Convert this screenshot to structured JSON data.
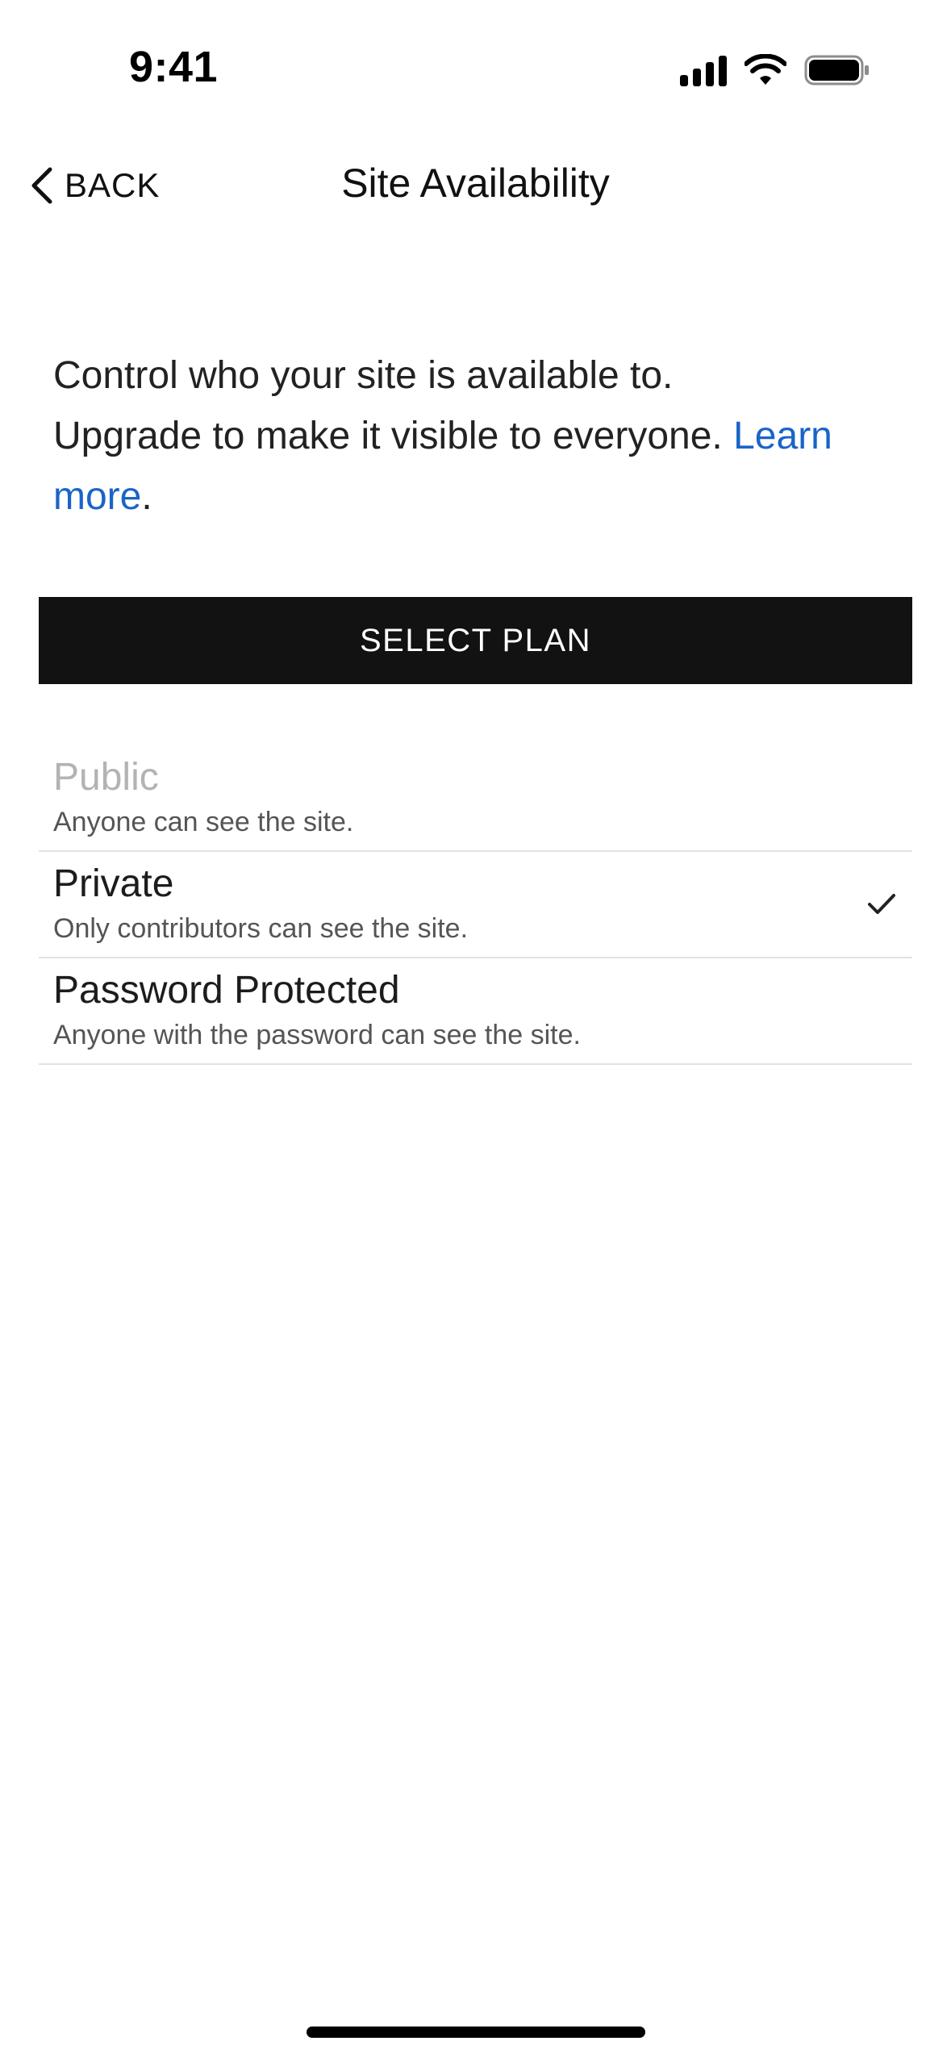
{
  "status_bar": {
    "time": "9:41"
  },
  "nav": {
    "back_label": "BACK",
    "title": "Site Availability"
  },
  "description": {
    "line1": "Control who your site is available to.",
    "line2": "Upgrade to make it visible to everyone.",
    "link": "Learn more",
    "period": "."
  },
  "select_plan_label": "SELECT PLAN",
  "options": [
    {
      "title": "Public",
      "description": "Anyone can see the site.",
      "disabled": true,
      "selected": false
    },
    {
      "title": "Private",
      "description": "Only contributors can see the site.",
      "disabled": false,
      "selected": true
    },
    {
      "title": "Password Protected",
      "description": "Anyone with the password can see the site.",
      "disabled": false,
      "selected": false
    }
  ],
  "colors": {
    "link": "#1a64c8",
    "button_bg": "#121212",
    "disabled_text": "#b3b3b3"
  },
  "icons": {
    "back": "chevron-left-icon",
    "selected": "checkmark-icon"
  }
}
